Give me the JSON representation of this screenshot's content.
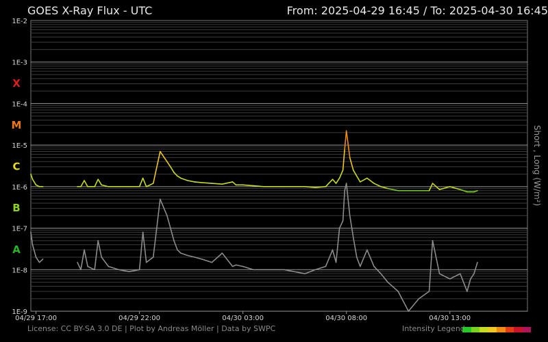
{
  "header": {
    "left_title": "GOES X-Ray Flux - UTC",
    "right_title": "From: 2025-04-29 16:45  /  To: 2025-04-30 16:45"
  },
  "footer": {
    "license": "License: CC BY-SA 3.0 DE | Plot by Andreas Möller | Data by SWPC",
    "legend_label": "Intensity Legend"
  },
  "legend_colors": [
    "#28c828",
    "#78d21e",
    "#c8dc1e",
    "#f0c81e",
    "#f08c14",
    "#e63c14",
    "#cc1428",
    "#b0145a"
  ],
  "classes": [
    {
      "label": "X",
      "color": "#dc1e1e"
    },
    {
      "label": "M",
      "color": "#f07814"
    },
    {
      "label": "C",
      "color": "#e6dc1e"
    },
    {
      "label": "B",
      "color": "#8cd21e"
    },
    {
      "label": "A",
      "color": "#28b428"
    }
  ],
  "chart_data": {
    "type": "line",
    "title": "GOES X-Ray Flux - UTC",
    "ylabel": "Short , Long (W/m²)",
    "yscale": "log",
    "ylim": [
      1e-09,
      0.01
    ],
    "ytick_labels": [
      "1E-2",
      "1E-3",
      "1E-4",
      "1E-5",
      "1E-6",
      "1E-7",
      "1E-8",
      "1E-9"
    ],
    "xlim": [
      "2025-04-29 16:45",
      "2025-04-30 16:45"
    ],
    "xtick_labels": [
      "04/29 17:00",
      "04/29 22:00",
      "04/30 03:00",
      "04/30 08:00",
      "04/30 13:00"
    ],
    "grid": true,
    "series": [
      {
        "name": "Long",
        "color_scale": "intensity",
        "x": [
          "2025-04-29 16:45",
          "2025-04-29 16:50",
          "2025-04-29 17:00",
          "2025-04-29 17:10",
          "2025-04-29 17:20",
          "2025-04-29 18:30",
          "2025-04-29 19:00",
          "2025-04-29 19:10",
          "2025-04-29 19:20",
          "2025-04-29 19:30",
          "2025-04-29 19:50",
          "2025-04-29 20:00",
          "2025-04-29 20:10",
          "2025-04-29 20:30",
          "2025-04-29 21:00",
          "2025-04-29 21:30",
          "2025-04-29 22:00",
          "2025-04-29 22:10",
          "2025-04-29 22:20",
          "2025-04-29 22:40",
          "2025-04-29 23:00",
          "2025-04-29 23:20",
          "2025-04-29 23:30",
          "2025-04-29 23:40",
          "2025-04-29 23:50",
          "2025-04-30 00:00",
          "2025-04-30 00:20",
          "2025-04-30 00:40",
          "2025-04-30 01:00",
          "2025-04-30 01:30",
          "2025-04-30 02:00",
          "2025-04-30 02:30",
          "2025-04-30 02:40",
          "2025-04-30 03:00",
          "2025-04-30 03:30",
          "2025-04-30 04:00",
          "2025-04-30 05:00",
          "2025-04-30 06:00",
          "2025-04-30 06:30",
          "2025-04-30 07:00",
          "2025-04-30 07:20",
          "2025-04-30 07:30",
          "2025-04-30 07:40",
          "2025-04-30 07:50",
          "2025-04-30 07:55",
          "2025-04-30 08:00",
          "2025-04-30 08:10",
          "2025-04-30 08:20",
          "2025-04-30 08:30",
          "2025-04-30 08:40",
          "2025-04-30 09:00",
          "2025-04-30 09:20",
          "2025-04-30 09:40",
          "2025-04-30 10:00",
          "2025-04-30 10:30",
          "2025-04-30 11:00",
          "2025-04-30 11:30",
          "2025-04-30 12:00",
          "2025-04-30 12:10",
          "2025-04-30 12:30",
          "2025-04-30 13:00",
          "2025-04-30 13:30",
          "2025-04-30 13:50",
          "2025-04-30 14:00",
          "2025-04-30 14:10",
          "2025-04-30 14:20"
        ],
        "y": [
          2e-06,
          1.5e-06,
          1.1e-06,
          1e-06,
          1e-06,
          null,
          1e-06,
          1e-06,
          1.4e-06,
          1e-06,
          1e-06,
          1.5e-06,
          1.1e-06,
          1e-06,
          1e-06,
          1e-06,
          1e-06,
          1.6e-06,
          1e-06,
          1.2e-06,
          7e-06,
          4e-06,
          3e-06,
          2.2e-06,
          1.8e-06,
          1.6e-06,
          1.4e-06,
          1.3e-06,
          1.25e-06,
          1.2e-06,
          1.15e-06,
          1.3e-06,
          1.1e-06,
          1.1e-06,
          1.05e-06,
          1e-06,
          1e-06,
          1e-06,
          9.5e-07,
          1e-06,
          1.5e-06,
          1.2e-06,
          1.6e-06,
          2.5e-06,
          8e-06,
          2.2e-05,
          5e-06,
          2.5e-06,
          1.8e-06,
          1.3e-06,
          1.6e-06,
          1.2e-06,
          1e-06,
          9e-07,
          8e-07,
          8e-07,
          8e-07,
          8e-07,
          1.2e-06,
          8.5e-07,
          1e-06,
          8.5e-07,
          7.5e-07,
          7.5e-07,
          7.5e-07,
          8e-07
        ]
      },
      {
        "name": "Short",
        "color": "#8c8c8c",
        "x": [
          "2025-04-29 16:45",
          "2025-04-29 16:50",
          "2025-04-29 17:00",
          "2025-04-29 17:10",
          "2025-04-29 17:20",
          "2025-04-29 18:30",
          "2025-04-29 19:00",
          "2025-04-29 19:10",
          "2025-04-29 19:20",
          "2025-04-29 19:30",
          "2025-04-29 19:50",
          "2025-04-29 20:00",
          "2025-04-29 20:10",
          "2025-04-29 20:30",
          "2025-04-29 21:00",
          "2025-04-29 21:30",
          "2025-04-29 22:00",
          "2025-04-29 22:10",
          "2025-04-29 22:20",
          "2025-04-29 22:40",
          "2025-04-29 23:00",
          "2025-04-29 23:20",
          "2025-04-29 23:30",
          "2025-04-29 23:40",
          "2025-04-29 23:50",
          "2025-04-30 00:00",
          "2025-04-30 00:20",
          "2025-04-30 00:40",
          "2025-04-30 01:00",
          "2025-04-30 01:30",
          "2025-04-30 02:00",
          "2025-04-30 02:30",
          "2025-04-30 02:40",
          "2025-04-30 03:00",
          "2025-04-30 03:30",
          "2025-04-30 04:00",
          "2025-04-30 05:00",
          "2025-04-30 06:00",
          "2025-04-30 06:30",
          "2025-04-30 07:00",
          "2025-04-30 07:20",
          "2025-04-30 07:30",
          "2025-04-30 07:40",
          "2025-04-30 07:50",
          "2025-04-30 07:55",
          "2025-04-30 08:00",
          "2025-04-30 08:10",
          "2025-04-30 08:20",
          "2025-04-30 08:30",
          "2025-04-30 08:40",
          "2025-04-30 09:00",
          "2025-04-30 09:20",
          "2025-04-30 09:40",
          "2025-04-30 10:00",
          "2025-04-30 10:30",
          "2025-04-30 11:00",
          "2025-04-30 11:30",
          "2025-04-30 12:00",
          "2025-04-30 12:10",
          "2025-04-30 12:30",
          "2025-04-30 13:00",
          "2025-04-30 13:30",
          "2025-04-30 13:50",
          "2025-04-30 14:00",
          "2025-04-30 14:10",
          "2025-04-30 14:20"
        ],
        "y": [
          8e-08,
          4e-08,
          2e-08,
          1.5e-08,
          1.8e-08,
          null,
          1.5e-08,
          1e-08,
          3e-08,
          1.2e-08,
          1e-08,
          5e-08,
          2e-08,
          1.2e-08,
          1e-08,
          9e-09,
          1e-08,
          8e-08,
          1.5e-08,
          2e-08,
          5e-07,
          2e-07,
          1e-07,
          5e-08,
          3e-08,
          2.5e-08,
          2.2e-08,
          2e-08,
          1.8e-08,
          1.5e-08,
          2.5e-08,
          1.2e-08,
          1.3e-08,
          1.2e-08,
          1e-08,
          1e-08,
          1e-08,
          8e-09,
          1e-08,
          1.2e-08,
          3e-08,
          1.5e-08,
          1e-07,
          1.5e-07,
          8e-07,
          1.2e-06,
          2e-07,
          6e-08,
          2e-08,
          1.2e-08,
          3e-08,
          1.2e-08,
          8e-09,
          5e-09,
          3e-09,
          1e-09,
          2e-09,
          3e-09,
          5e-08,
          8e-09,
          6e-09,
          8e-09,
          3e-09,
          6e-09,
          8e-09,
          1.5e-08
        ]
      }
    ]
  }
}
